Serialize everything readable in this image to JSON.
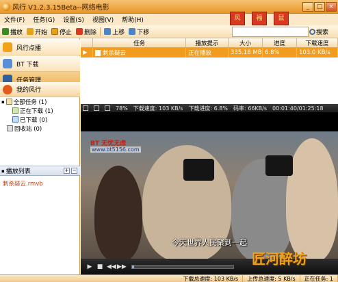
{
  "window": {
    "title": "风行 V1.2.3.15Beta--网络电影",
    "controls": [
      "_",
      "□",
      "×"
    ]
  },
  "menu": [
    "文件(F)",
    "任务(G)",
    "设置(S)",
    "视图(V)",
    "帮助(H)"
  ],
  "toolbar": {
    "play": "播放",
    "start": "开始",
    "stop": "停止",
    "delete": "删除",
    "up": "上移",
    "down": "下移",
    "search_label": "搜索"
  },
  "banner": [
    "风",
    "福",
    "鼠"
  ],
  "sidebar": {
    "items": [
      {
        "label": "风行点播"
      },
      {
        "label": "BT 下载"
      },
      {
        "label": "任务管理"
      },
      {
        "label": "我的风行"
      }
    ]
  },
  "tree": {
    "all": "全部任务 (1)",
    "downloading": "正在下载 (1)",
    "done": "已下载 (0)",
    "recycle": "回收站 (0)"
  },
  "playlist": {
    "header": "播放列表",
    "item": "刺杀疑云.rmvb"
  },
  "table": {
    "headers": [
      "任务",
      "播放提示",
      "大小",
      "进度",
      "下载速度"
    ],
    "row": {
      "name": "刺杀疑云",
      "status": "正在播放",
      "size": "335.18 MB",
      "progress": "6.8%",
      "speed": "103.0 KB/s"
    }
  },
  "player": {
    "volume": "78%",
    "speed": "下载速度: 103 KB/s",
    "progress": "下载进度: 6.8%",
    "bitrate": "码率: 66KB/s",
    "time": "00:01:40/01:25:18",
    "logo": "BT 无忧无虑",
    "url": "www.bt5156.com",
    "subtitle": "今天世界人民聚到一起",
    "seek_fraction": 0.02,
    "watermark": "匠河醉坊"
  },
  "statusbar": {
    "down": "下载总速度: 103 KB/s",
    "up": "上传总速度: 5 KB/s",
    "tasks": "正在任务: 1"
  }
}
